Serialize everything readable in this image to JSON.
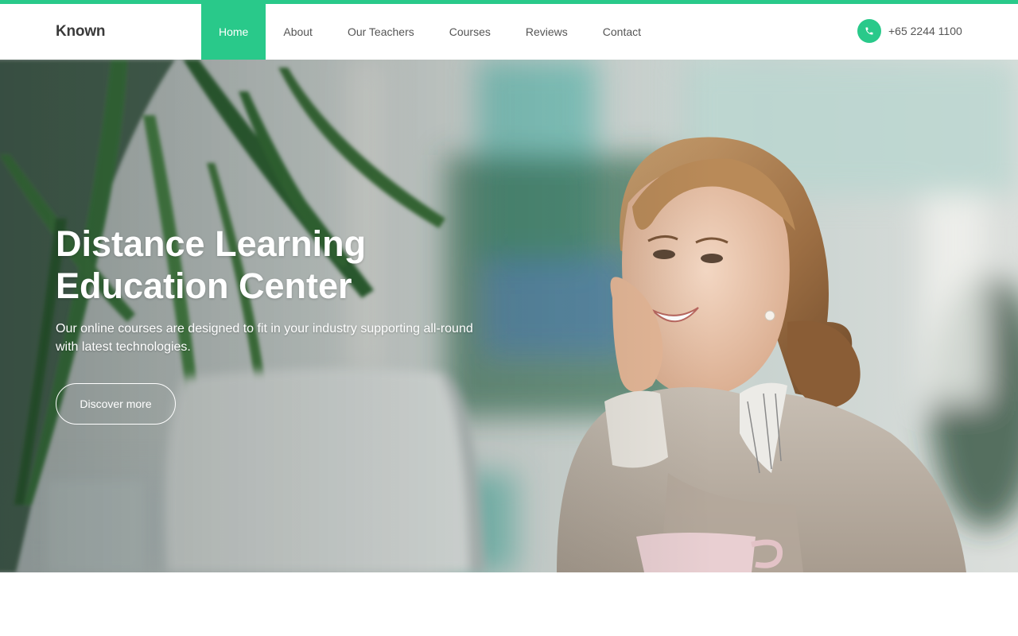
{
  "colors": {
    "accent": "#29c98a",
    "nav_text": "#555555",
    "brand_text": "#3a3a3a"
  },
  "header": {
    "brand": "Known",
    "nav": [
      {
        "label": "Home",
        "active": true
      },
      {
        "label": "About",
        "active": false
      },
      {
        "label": "Our Teachers",
        "active": false
      },
      {
        "label": "Courses",
        "active": false
      },
      {
        "label": "Reviews",
        "active": false
      },
      {
        "label": "Contact",
        "active": false
      }
    ],
    "phone": {
      "icon": "phone-icon",
      "number": "+65 2244 1100"
    }
  },
  "hero": {
    "title_line1": "Distance Learning",
    "title_line2": "Education Center",
    "subtitle": "Our online courses are designed to fit in your industry supporting all-round with latest technologies.",
    "cta_label": "Discover more"
  }
}
